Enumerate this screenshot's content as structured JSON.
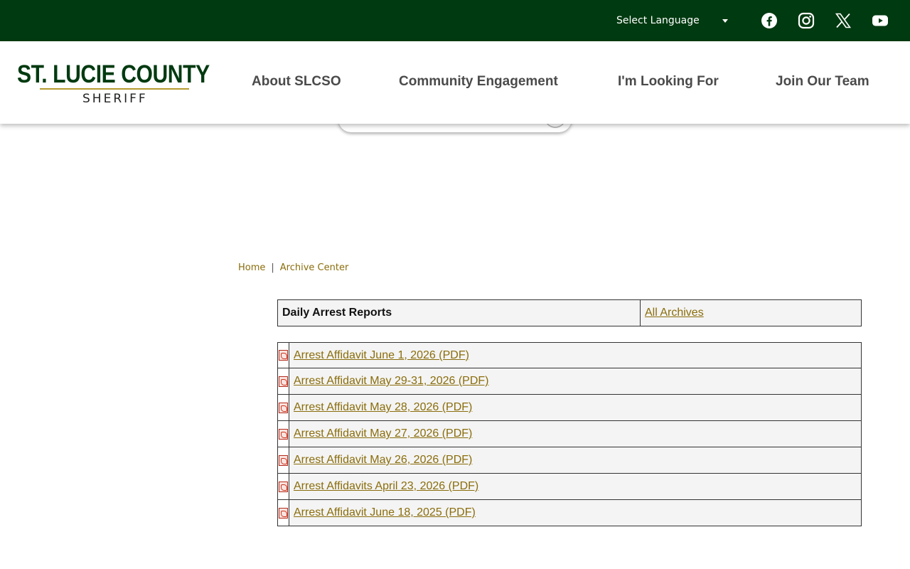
{
  "topbar": {
    "language_label": "Select Language",
    "social": [
      "facebook-icon",
      "instagram-icon",
      "x-icon",
      "youtube-icon"
    ]
  },
  "logo": {
    "main": "ST. LUCIE COUNTY",
    "sub": "SHERIFF"
  },
  "nav": [
    "About SLCSO",
    "Community Engagement",
    "I'm Looking For",
    "Join Our Team"
  ],
  "breadcrumb": {
    "home": "Home",
    "separator": "|",
    "current": "Archive Center"
  },
  "category": {
    "title": "Daily Arrest Reports",
    "all_link": "All Archives"
  },
  "documents": [
    "Arrest Affidavit June 1, 2026 (PDF)",
    "Arrest Affidavit May 29-31, 2026 (PDF)",
    "Arrest Affidavit May 28, 2026 (PDF)",
    "Arrest Affidavit May 27, 2026 (PDF)",
    "Arrest Affidavit May 26, 2026 (PDF)",
    "Arrest Affidavits April 23, 2026 (PDF)",
    "Arrest Affidavit June 18, 2025 (PDF)"
  ],
  "colors": {
    "brand_green": "#003a10",
    "link_gold": "#8a6d0b",
    "logo_rule": "#b59a2e"
  }
}
